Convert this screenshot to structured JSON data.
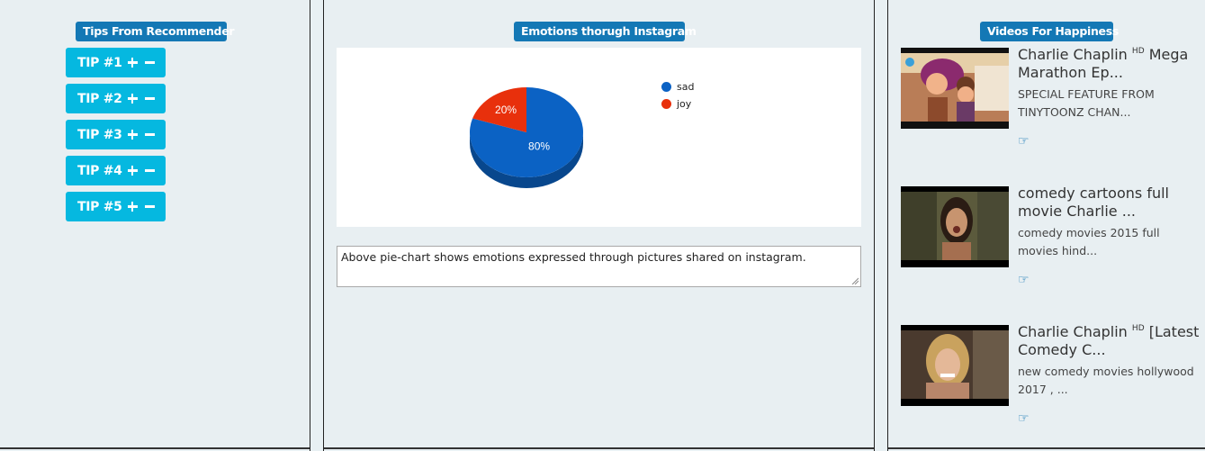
{
  "left_panel": {
    "title": "Tips From Recommender",
    "tips": [
      {
        "label": "TIP #1"
      },
      {
        "label": "TIP #2"
      },
      {
        "label": "TIP #3"
      },
      {
        "label": "TIP #4"
      },
      {
        "label": "TIP #5"
      }
    ]
  },
  "center_panel": {
    "title": "Emotions thorugh Instagram",
    "caption": "Above pie-chart shows emotions expressed through pictures shared on instagram."
  },
  "chart_data": {
    "type": "pie",
    "title": "",
    "slices": [
      {
        "label": "sad",
        "value": 80,
        "color": "#0b62c4",
        "label_text": "80%"
      },
      {
        "label": "joy",
        "value": 20,
        "color": "#e8300c",
        "label_text": "20%"
      }
    ],
    "legend_position": "top-right"
  },
  "right_panel": {
    "title": "Videos For Happiness",
    "videos": [
      {
        "title": "Charlie Chaplin",
        "hd": "HD",
        "title_rest": "Mega Marathon Ep...",
        "description": "SPECIAL FEATURE FROM TINYTOONZ CHAN...",
        "icon": "hand-pointer-icon"
      },
      {
        "title": "comedy cartoons full movie Charlie ...",
        "hd": "",
        "title_rest": "",
        "description": "comedy movies 2015 full movies hind...",
        "icon": "hand-pointer-icon"
      },
      {
        "title": "Charlie Chaplin",
        "hd": "HD",
        "title_rest": "[Latest Comedy C...",
        "description": "new comedy movies hollywood 2017 , ...",
        "icon": "hand-pointer-icon"
      }
    ]
  }
}
